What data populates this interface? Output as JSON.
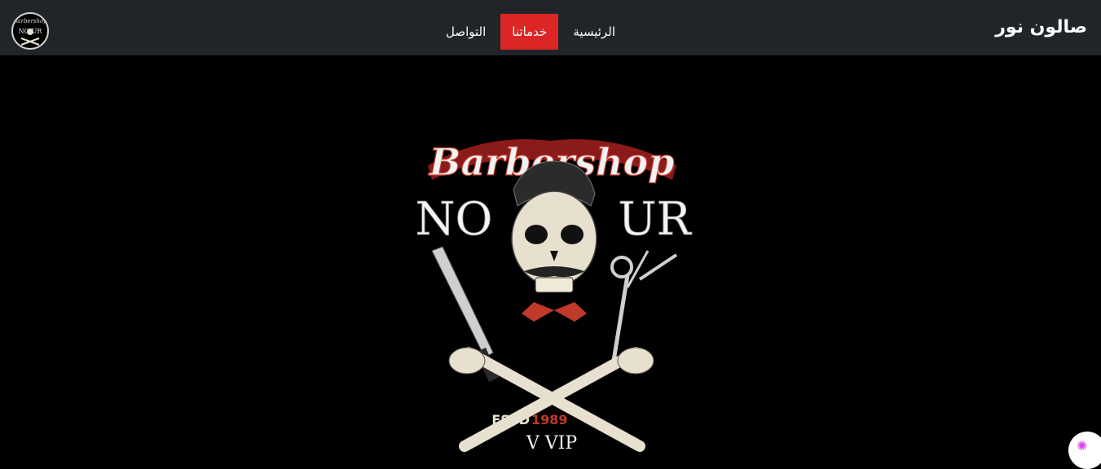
{
  "navbar": {
    "brand": "صالون نور",
    "links": [
      {
        "label": "الرئيسية",
        "active": false
      },
      {
        "label": "خدماتنا",
        "active": true
      },
      {
        "label": "التواصل",
        "active": false
      }
    ],
    "logo_icon": "barbershop-logo-icon"
  },
  "hero": {
    "logo": {
      "script": "Barbershop",
      "name_left": "NO",
      "name_right": "UR",
      "estd_prefix": "ESTD",
      "estd_year": "1989",
      "tagline": "V VIP"
    }
  },
  "small_logo": {
    "script": "Barbershop",
    "name": "NO UR"
  },
  "colors": {
    "navbar_bg": "#212529",
    "active_bg": "#dc2626",
    "hero_bg": "#000000",
    "logo_red": "#c0392b"
  },
  "assistant": {
    "icon": "brain-icon"
  }
}
